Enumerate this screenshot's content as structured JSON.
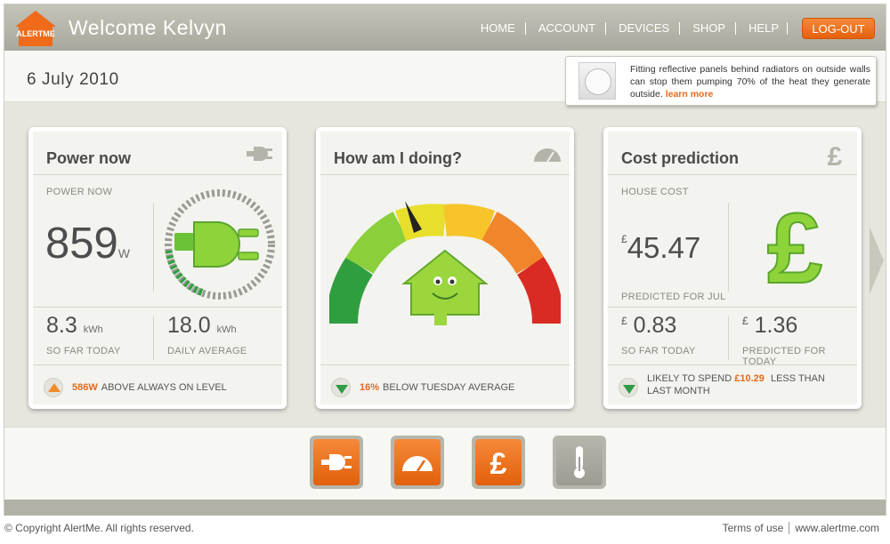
{
  "header": {
    "logo_text": "ALERTME",
    "welcome": "Welcome Kelvyn",
    "nav": [
      "HOME",
      "ACCOUNT",
      "DEVICES",
      "SHOP",
      "HELP"
    ],
    "logout": "LOG-OUT",
    "colors": {
      "accent": "#e5600c",
      "header_bg": "#b3b2a7"
    }
  },
  "datebar": {
    "date": "6 July 2010",
    "tip_text": "Fitting reflective panels behind radiators on outside walls can stop them pumping 70% of the heat they generate outside.",
    "tip_link": "learn more"
  },
  "power": {
    "title": "Power now",
    "icon": "plug-icon",
    "label": "POWER NOW",
    "value": "859",
    "unit": "W",
    "so_far": "8.3",
    "so_far_unit": "kWh",
    "so_far_label": "SO FAR TODAY",
    "avg": "18.0",
    "avg_unit": "kWh",
    "avg_label": "DAILY AVERAGE",
    "status_value": "586W",
    "status_text": "ABOVE ALWAYS ON LEVEL",
    "status_direction": "up"
  },
  "doing": {
    "title": "How am I doing?",
    "icon": "gauge-icon",
    "status_value": "16%",
    "status_text": "BELOW TUESDAY AVERAGE",
    "status_direction": "down",
    "gauge_level": 0.3
  },
  "cost": {
    "title": "Cost prediction",
    "icon": "pound-icon",
    "label": "HOUSE COST",
    "currency": "£",
    "value": "45.47",
    "predicted_label": "PREDICTED FOR JUL",
    "so_far": "0.83",
    "so_far_label": "SO FAR TODAY",
    "pred_today": "1.36",
    "pred_today_label": "PREDICTED FOR TODAY",
    "status_pre": "LIKELY TO SPEND",
    "status_value": "£10.29",
    "status_post": "LESS THAN LAST MONTH",
    "status_direction": "down"
  },
  "bottom_nav": [
    "plug-icon",
    "gauge-icon",
    "pound-icon",
    "thermometer-icon"
  ],
  "footer": {
    "copyright": "© Copyright AlertMe. All rights reserved.",
    "terms": "Terms of use",
    "site": "www.alertme.com"
  }
}
